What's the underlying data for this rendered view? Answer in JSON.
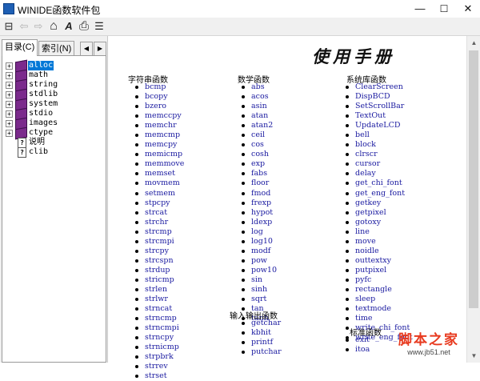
{
  "window": {
    "title": "WINIDE函数软件包",
    "buttons": {
      "minimize": "—",
      "maximize": "☐",
      "close": "✕"
    }
  },
  "toolbar": {
    "icons": [
      "hide-pane-icon",
      "back-icon",
      "forward-icon",
      "home-icon",
      "font-icon",
      "print-icon",
      "options-icon"
    ],
    "glyphs": {
      "hide": "⊟",
      "back": "⇦",
      "forward": "⇨",
      "home": "⌂",
      "font": "A",
      "print": "⎙",
      "options": "☰"
    }
  },
  "tabs": [
    {
      "label": "目录(C)",
      "active": true
    },
    {
      "label": "索引(N)",
      "active": false
    }
  ],
  "tree": {
    "items": [
      {
        "label": "alloc",
        "type": "book",
        "selected": true
      },
      {
        "label": "math",
        "type": "book"
      },
      {
        "label": "string",
        "type": "book"
      },
      {
        "label": "stdlib",
        "type": "book"
      },
      {
        "label": "system",
        "type": "book"
      },
      {
        "label": "stdio",
        "type": "book"
      },
      {
        "label": "images",
        "type": "book"
      },
      {
        "label": "ctype",
        "type": "book"
      },
      {
        "label": "说明",
        "type": "page"
      },
      {
        "label": "clib",
        "type": "page"
      }
    ]
  },
  "main": {
    "heading": "使用手册",
    "columns": [
      {
        "title": "字符串函数",
        "items": [
          "bcmp",
          "bcopy",
          "bzero",
          "memccpy",
          "memchr",
          "memcmp",
          "memcpy",
          "memicmp",
          "memmove",
          "memset",
          "movmem",
          "setmem",
          "stpcpy",
          "strcat",
          "strchr",
          "strcmp",
          "strcmpi",
          "strcpy",
          "strcspn",
          "strdup",
          "stricmp",
          "strlen",
          "strlwr",
          "strncat",
          "strncmp",
          "strncmpi",
          "strncpy",
          "strnicmp",
          "strpbrk",
          "strrev",
          "strset"
        ]
      },
      {
        "title": "数学函数",
        "items": [
          "abs",
          "acos",
          "asin",
          "atan",
          "atan2",
          "ceil",
          "cos",
          "cosh",
          "exp",
          "fabs",
          "floor",
          "fmod",
          "frexp",
          "hypot",
          "ldexp",
          "log",
          "log10",
          "modf",
          "pow",
          "pow10",
          "sin",
          "sinh",
          "sqrt",
          "tan",
          "tanh"
        ]
      },
      {
        "title": "系统库函数",
        "items": [
          "ClearScreen",
          "DispBCD",
          "SetScrollBar",
          "TextOut",
          "UpdateLCD",
          "bell",
          "block",
          "clrscr",
          "cursor",
          "delay",
          "get_chi_font",
          "get_eng_font",
          "getkey",
          "getpixel",
          "gotoxy",
          "line",
          "move",
          "noidle",
          "outtextxy",
          "putpixel",
          "pyfc",
          "rectangle",
          "sleep",
          "textmode",
          "time",
          "write_chi_font",
          "write_eng_font"
        ]
      },
      {
        "title": "输入输出函数",
        "items": [
          "getchar",
          "kbhit",
          "printf",
          "putchar"
        ]
      },
      {
        "title": "标准函数",
        "items": [
          "exit",
          "itoa"
        ]
      }
    ]
  },
  "watermark": {
    "line1": "脚本之家",
    "line2": "www.jb51.net"
  }
}
